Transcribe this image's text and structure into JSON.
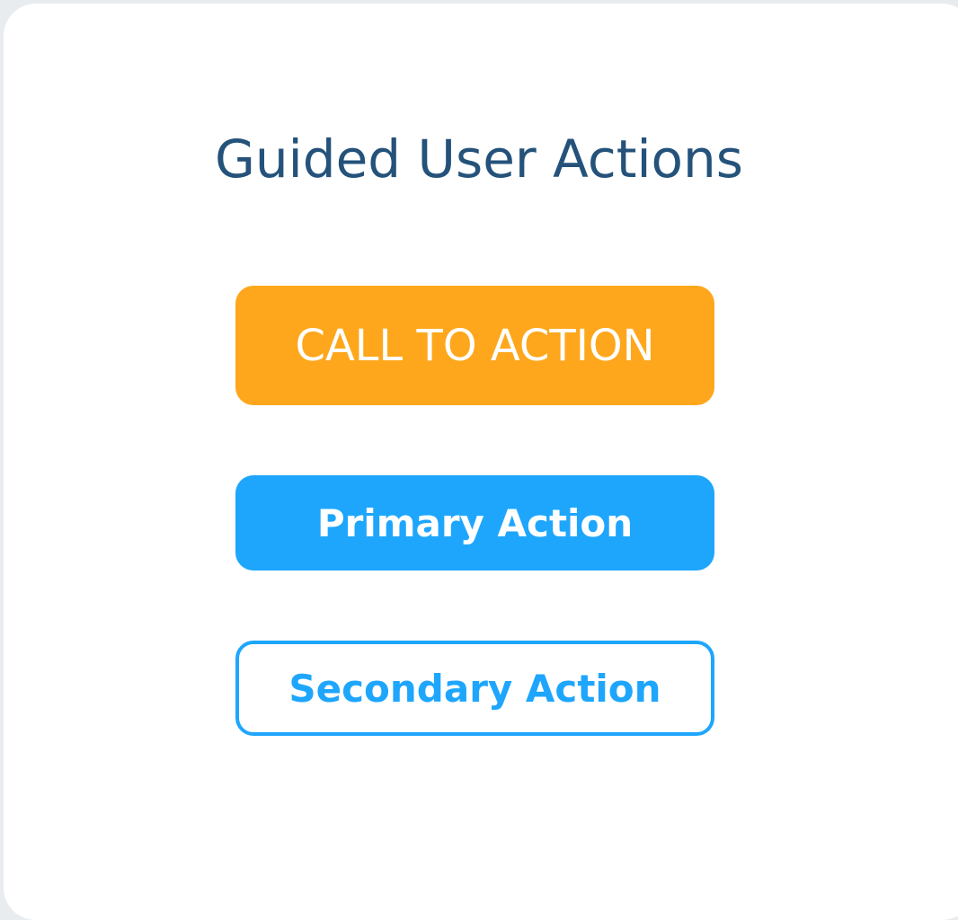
{
  "page": {
    "title": "Guided User Actions"
  },
  "buttons": {
    "call_to_action": "CALL TO ACTION",
    "primary": "Primary Action",
    "secondary": "Secondary Action"
  },
  "colors": {
    "background": "#e9ecef",
    "card": "#ffffff",
    "title": "#24527a",
    "call_to_action": "#fea71c",
    "primary": "#1ea6fd",
    "secondary_border": "#1ea6fd",
    "button_text_light": "#ffffff"
  }
}
